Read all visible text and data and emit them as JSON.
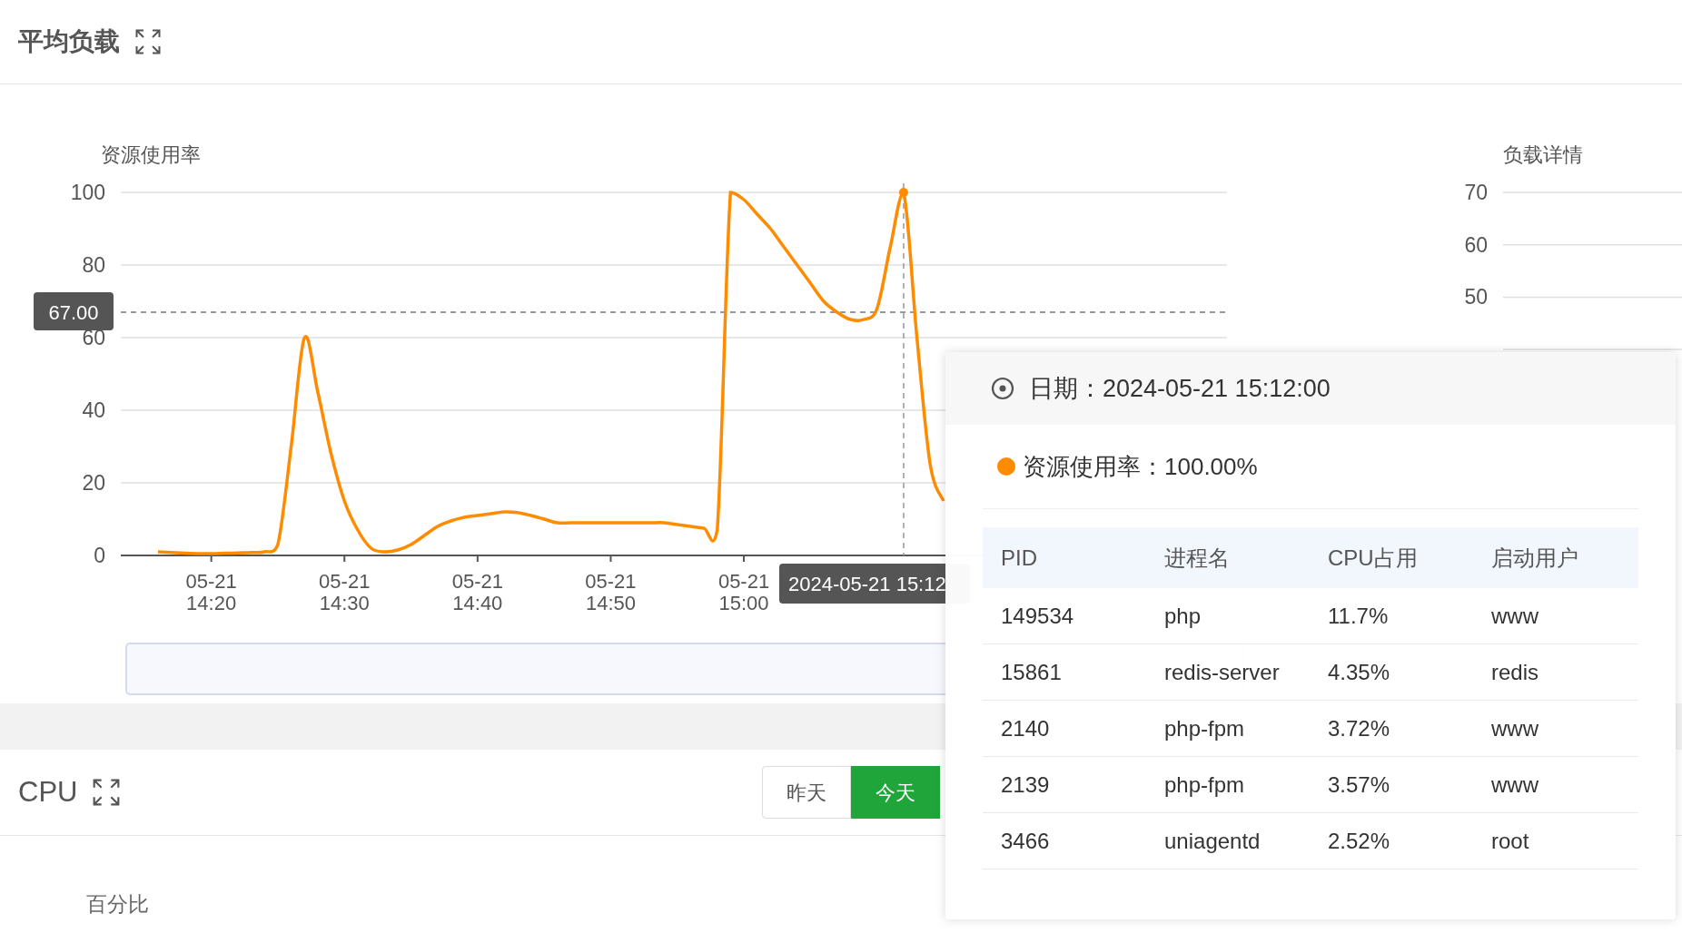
{
  "load_panel": {
    "title": "平均负载",
    "usage_chart": {
      "chart_data": {
        "type": "line",
        "grid": true,
        "ylabel": "资源使用率",
        "ylim": [
          0,
          100
        ],
        "yticks": [
          0,
          20,
          40,
          60,
          80,
          100
        ],
        "categories": [
          null,
          null,
          null,
          null,
          "05-21\n14:20",
          null,
          null,
          null,
          null,
          null,
          null,
          null,
          null,
          null,
          "05-21\n14:30",
          null,
          null,
          null,
          null,
          null,
          null,
          null,
          null,
          null,
          "05-21\n14:40",
          null,
          null,
          null,
          null,
          null,
          null,
          null,
          null,
          null,
          "05-21\n14:50",
          null,
          null,
          null,
          null,
          null,
          null,
          null,
          null,
          null,
          "05-21\n15:00",
          null,
          null,
          null,
          null,
          null,
          null,
          null,
          null,
          null,
          null,
          null,
          null,
          null,
          null,
          null
        ],
        "series": [
          {
            "color": "#ff8c00",
            "values": [
              1,
              0.8,
              0.6,
              0.5,
              0.5,
              0.6,
              0.7,
              0.8,
              1,
              3,
              30,
              60,
              45,
              28,
              15,
              7,
              2,
              1,
              1.5,
              3,
              5.5,
              8,
              9.5,
              10.5,
              11,
              11.5,
              12,
              11.8,
              11,
              10,
              9,
              9,
              9,
              9,
              9,
              9,
              9,
              9,
              9,
              8.5,
              8,
              7.5,
              7,
              100,
              98,
              94,
              90,
              85,
              80,
              75,
              70,
              67,
              65,
              65,
              68,
              85,
              100,
              60,
              25,
              15
            ]
          }
        ],
        "ref_lines": [
          {
            "axis": "y",
            "value": 67,
            "label": "67.00",
            "color": "#777777"
          }
        ]
      },
      "pointer": {
        "label": "2024-05-21 15:12"
      }
    },
    "detail_chart": {
      "title": "负载详情",
      "y_labels": [
        "70",
        "60",
        "50"
      ]
    }
  },
  "cpu_panel": {
    "title": "CPU",
    "range_buttons": [
      {
        "label": "昨天",
        "selected": false
      },
      {
        "label": "今天",
        "selected": true
      }
    ],
    "ylabel": "百分比"
  },
  "tooltip": {
    "title": "日期：2024-05-21 15:12:00",
    "series": {
      "label": "资源使用率：100.00%",
      "color": "#ff8c00"
    },
    "table": {
      "columns": [
        "PID",
        "进程名",
        "CPU占用",
        "启动用户"
      ],
      "rows": [
        [
          "149534",
          "php",
          "11.7%",
          "www"
        ],
        [
          "15861",
          "redis-server",
          "4.35%",
          "redis"
        ],
        [
          "2140",
          "php-fpm",
          "3.72%",
          "www"
        ],
        [
          "2139",
          "php-fpm",
          "3.57%",
          "www"
        ],
        [
          "3466",
          "uniagentd",
          "2.52%",
          "root"
        ]
      ]
    }
  }
}
